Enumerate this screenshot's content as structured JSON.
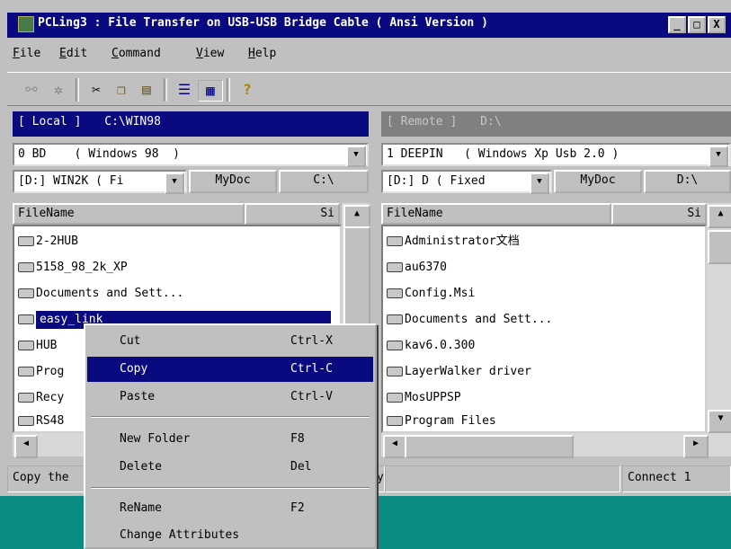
{
  "window": {
    "title": "PCLing3 : File Transfer on USB-USB Bridge Cable ( Ansi Version )",
    "controls": [
      "_",
      "□",
      "X"
    ]
  },
  "menubar": [
    {
      "label": "File",
      "key": "F",
      "rest": "ile"
    },
    {
      "label": "Edit",
      "key": "E",
      "rest": "dit"
    },
    {
      "label": "Command",
      "key": "C",
      "rest": "ommand"
    },
    {
      "label": "View",
      "key": "V",
      "rest": "iew"
    },
    {
      "label": "Help",
      "key": "H",
      "rest": "elp"
    }
  ],
  "toolbar": {
    "icons": [
      "connect-icon",
      "settings-icon",
      "cut-icon",
      "copy-icon",
      "paste-icon",
      "list-view-icon",
      "details-view-icon",
      "help-icon"
    ]
  },
  "left_panel": {
    "header_tag": "[ Local ]",
    "header_path": "C:\\WIN98",
    "computer": "0 BD    ( Windows 98  )",
    "drive": "[D:] WIN2K ( Fi",
    "mydoc_label": "MyDoc",
    "root_label": "C:\\",
    "col_name": "FileName",
    "col_size": "Si",
    "files": [
      "2-2HUB",
      "5158_98_2k_XP",
      "Documents and Sett...",
      "easy_link",
      "HUB",
      "Prog",
      "Recy",
      "RS48"
    ],
    "selected_index": 3
  },
  "right_panel": {
    "header_tag": "[ Remote ]",
    "header_path": "D:\\",
    "computer": "1 DEEPIN   ( Windows Xp Usb 2.0 )",
    "drive": "[D:] D ( Fixed",
    "mydoc_label": "MyDoc",
    "root_label": "D:\\",
    "col_name": "FileName",
    "col_size": "Si",
    "files": [
      "Administrator文档",
      "au6370",
      "Config.Msi",
      "Documents and Sett...",
      "kav6.0.300",
      "LayerWalker driver",
      "MosUPPSP",
      "Program Files"
    ]
  },
  "status": {
    "left_text": "Copy the",
    "mid_text": "y",
    "right_text": "Connect 1"
  },
  "context_menu": {
    "items": [
      {
        "label": "Cut",
        "shortcut": "Ctrl-X"
      },
      {
        "label": "Copy",
        "shortcut": "Ctrl-C"
      },
      {
        "label": "Paste",
        "shortcut": "Ctrl-V"
      },
      {
        "label": "New Folder",
        "shortcut": "F8"
      },
      {
        "label": "Delete",
        "shortcut": "Del"
      },
      {
        "label": "ReName",
        "shortcut": "F2"
      },
      {
        "label": "Change Attributes",
        "shortcut": ""
      }
    ],
    "highlighted_index": 1
  },
  "colors": {
    "title_bar": "#0a0a80",
    "desktop": "#0a8c84",
    "highlight": "#0a0a80",
    "inactive_header": "#808080"
  }
}
